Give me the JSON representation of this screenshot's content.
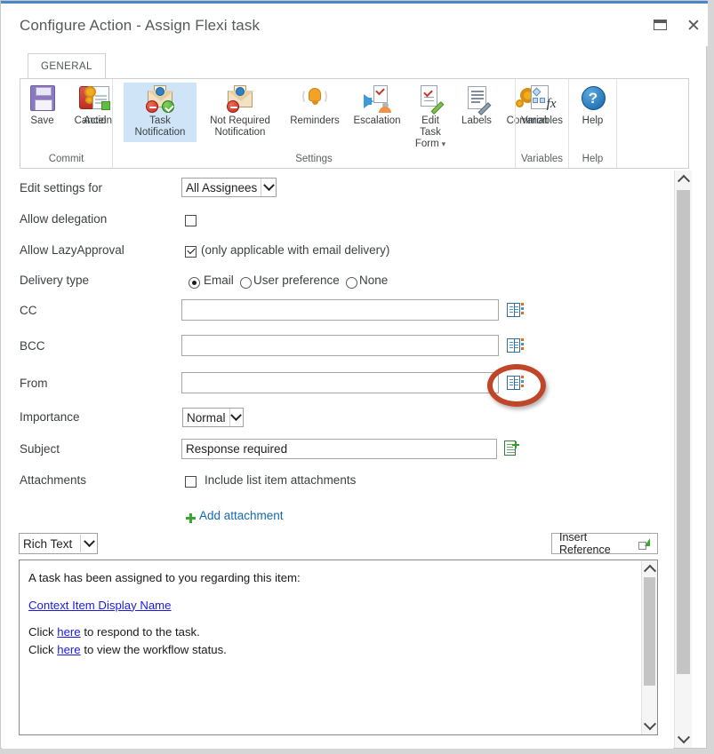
{
  "window": {
    "title": "Configure Action - Assign Flexi task",
    "restore_label": "Restore",
    "close_label": "✕"
  },
  "ribbon": {
    "tab": "GENERAL",
    "groups": [
      {
        "label": "Commit",
        "items": [
          {
            "label": "Save",
            "icon": "floppy-disk-icon",
            "selected": false
          },
          {
            "label": "Cancel",
            "icon": "red-x-icon",
            "selected": false
          }
        ]
      },
      {
        "label": "Settings",
        "items": [
          {
            "label": "Action",
            "icon": "gears-document-icon",
            "selected": false
          },
          {
            "label": "Task Notification",
            "icon": "envelope-task-icon",
            "selected": true
          },
          {
            "label": "Not Required Notification",
            "icon": "envelope-denied-icon",
            "selected": false
          },
          {
            "label": "Reminders",
            "icon": "bell-icon",
            "selected": false
          },
          {
            "label": "Escalation",
            "icon": "escalation-arrow-icon",
            "selected": false
          },
          {
            "label": "Edit Task Form",
            "icon": "clipboard-pencil-icon",
            "selected": false,
            "caret": true
          },
          {
            "label": "Labels",
            "icon": "lines-pencil-icon",
            "selected": false
          },
          {
            "label": "Common",
            "icon": "gear-icon",
            "selected": false
          }
        ]
      },
      {
        "label": "Variables",
        "items": [
          {
            "label": "Variables",
            "icon": "fx-variables-icon",
            "selected": false
          }
        ]
      },
      {
        "label": "Help",
        "items": [
          {
            "label": "Help",
            "icon": "question-mark-icon",
            "selected": false
          }
        ]
      }
    ]
  },
  "form": {
    "edit_settings_for": {
      "label": "Edit settings for",
      "value": "All Assignees"
    },
    "allow_delegation": {
      "label": "Allow delegation",
      "checked": false
    },
    "allow_lazyapproval": {
      "label": "Allow LazyApproval",
      "checked": true,
      "note": "(only applicable with email delivery)"
    },
    "delivery_type": {
      "label": "Delivery type",
      "options": [
        "Email",
        "User preference",
        "None"
      ],
      "selected": "Email"
    },
    "cc": {
      "label": "CC",
      "value": ""
    },
    "bcc": {
      "label": "BCC",
      "value": ""
    },
    "from": {
      "label": "From",
      "value": ""
    },
    "importance": {
      "label": "Importance",
      "value": "Normal"
    },
    "subject": {
      "label": "Subject",
      "value": "Response required"
    },
    "attachments": {
      "label": "Attachments",
      "checkbox_label": "Include list item attachments",
      "checked": false
    },
    "add_attachment": "Add attachment"
  },
  "editor": {
    "format": "Rich Text",
    "insert_reference": "Insert Reference",
    "body": {
      "line1": "A task has been assigned to you regarding this item:",
      "link_item": "Context Item Display Name",
      "line3_pre": "Click ",
      "line3_link": "here",
      "line3_post": " to respond to the task.",
      "line4_pre": "Click ",
      "line4_link": "here",
      "line4_post": " to view the workflow status."
    }
  },
  "annotation": {
    "shape": "ellipse-highlight",
    "target": "from-field-picker-icon",
    "color": "#c0462a"
  }
}
